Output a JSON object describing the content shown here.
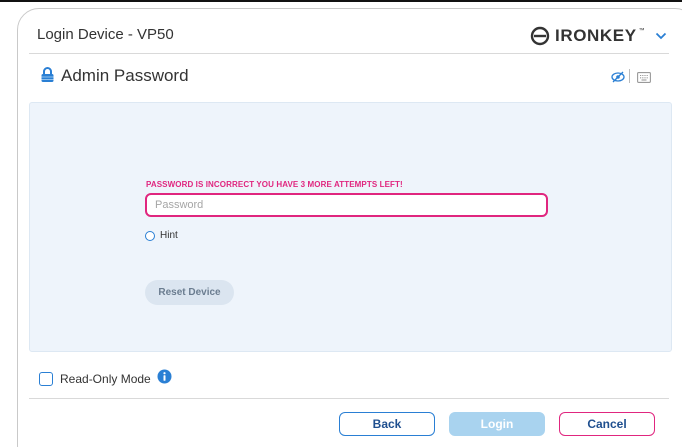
{
  "window": {
    "title": "Login Device - VP50"
  },
  "brand": {
    "name": "IRONKEY",
    "trademark": "™",
    "logo_icon": "ironkey-logo-icon",
    "menu_icon": "chevron-down-icon"
  },
  "section": {
    "title": "Admin Password",
    "icon": "lock-icon",
    "toolbar_icons": [
      "eye-slash-icon",
      "keyboard-icon"
    ]
  },
  "login_form": {
    "error_message": "PASSWORD IS INCORRECT YOU HAVE 3 MORE ATTEMPTS LEFT!",
    "password_placeholder": "Password",
    "password_value": "",
    "hint_label": "Hint",
    "reset_label": "Reset Device"
  },
  "options": {
    "read_only_label": "Read-Only Mode",
    "read_only_checked": false,
    "info_icon": "info-icon"
  },
  "buttons": {
    "back": "Back",
    "login": "Login",
    "cancel": "Cancel"
  },
  "colors": {
    "accent_blue": "#2a7fd4",
    "error_pink": "#e0267f",
    "panel_bg": "#eef4fb",
    "login_disabled": "#a9d3ef"
  }
}
